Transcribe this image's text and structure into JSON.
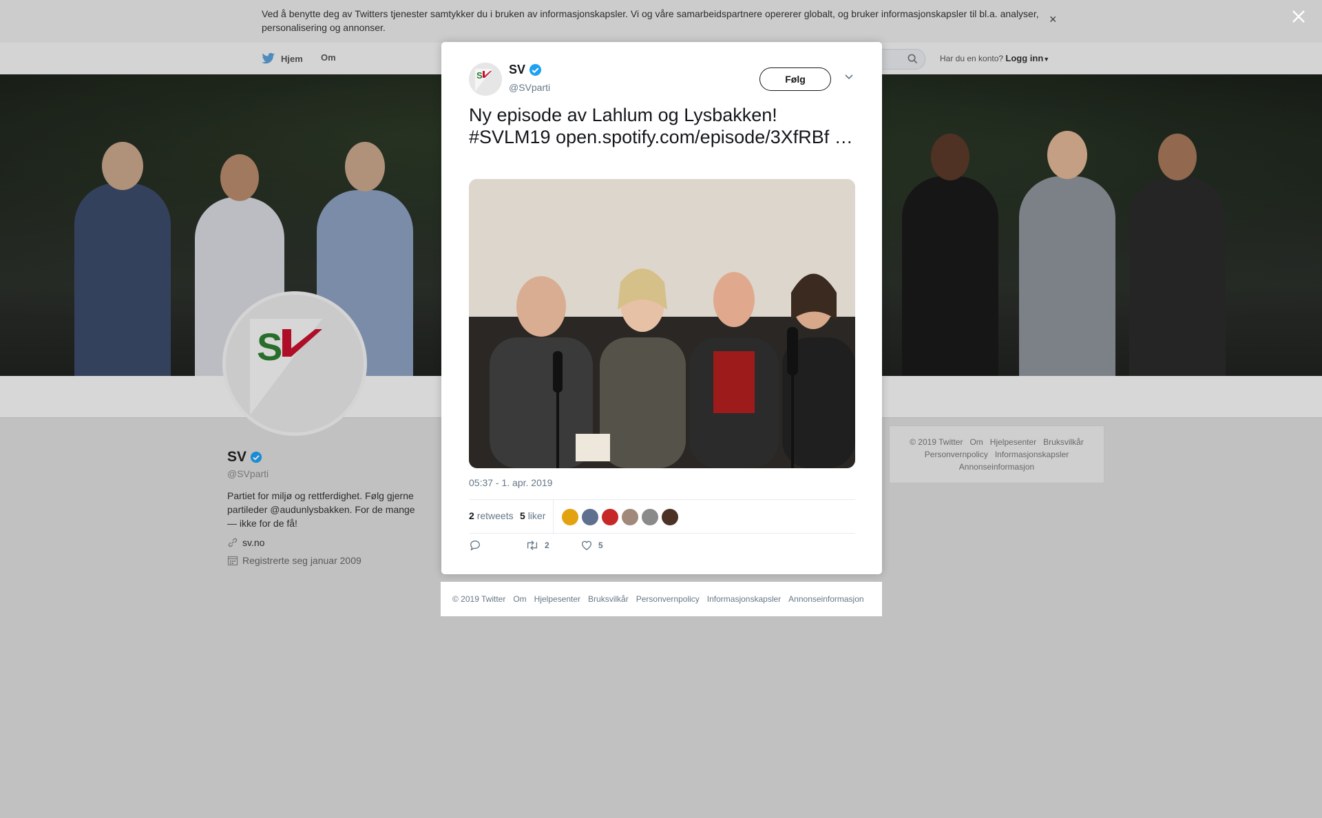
{
  "cookie": {
    "text": "Ved å benytte deg av Twitters tjenester samtykker du i bruken av informasjonskapsler. Vi og våre samarbeidspartnere opererer globalt, og bruker informasjonskapsler til bl.a. analyser, personalisering og annonser.",
    "close": "×"
  },
  "nav": {
    "home": "Hjem",
    "about": "Om",
    "account_prompt": "Har du en konto?",
    "login": "Logg inn"
  },
  "profile": {
    "name": "SV",
    "handle": "@SVparti",
    "bio": "Partiet for miljø og rettferdighet. Følg gjerne partileder @audunlysbakken. For de mange — ikke for de få!",
    "website": "sv.no",
    "joined": "Registrerte seg januar 2009"
  },
  "side_footer": {
    "links": [
      "© 2019 Twitter",
      "Om",
      "Hjelpesenter",
      "Bruksvilkår",
      "Personvernpolicy",
      "Informasjonskapsler",
      "Annonseinformasjon"
    ]
  },
  "tweet": {
    "name": "SV",
    "handle": "@SVparti",
    "follow": "Følg",
    "text": "Ny episode av Lahlum og Lysbakken! #SVLM19 open.spotify.com/episode/3XfRBf …",
    "timestamp": "05:37 - 1. apr. 2019",
    "retweets_count": "2",
    "retweets_label": "retweets",
    "likes_count": "5",
    "likes_label": "liker",
    "retweet_action_count": "2",
    "like_action_count": "5"
  },
  "modal_footer": {
    "links": [
      "© 2019 Twitter",
      "Om",
      "Hjelpesenter",
      "Bruksvilkår",
      "Personvernpolicy",
      "Informasjonskapsler",
      "Annonseinformasjon"
    ]
  },
  "colors": {
    "accent": "#1da1f2",
    "sv_red": "#c8102e",
    "sv_green": "#2e7d32"
  }
}
